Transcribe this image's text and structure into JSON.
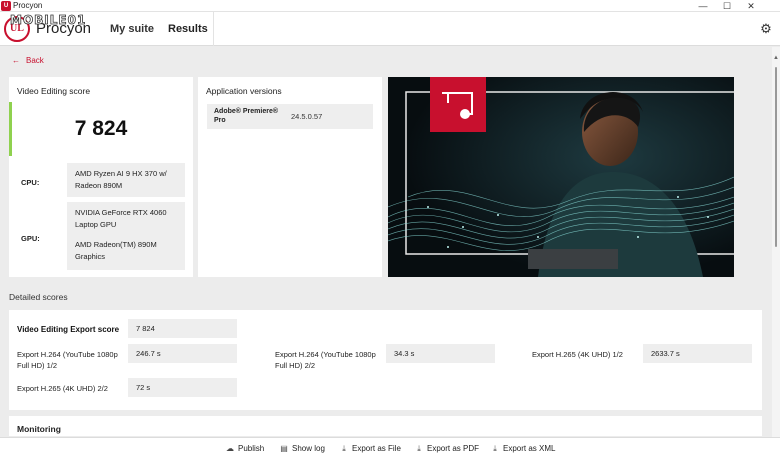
{
  "window": {
    "title": "Procyon",
    "minimize": "—",
    "maximize": "☐",
    "close": "✕"
  },
  "header": {
    "logo_text": "UL",
    "brand": "Procyon",
    "watermark": "MOBILE01",
    "tabs": [
      {
        "label": "My suite",
        "active": false
      },
      {
        "label": "Results",
        "active": true
      }
    ]
  },
  "back_label": "Back",
  "score_card": {
    "title": "Video Editing score",
    "score": "7 824",
    "accent_color": "#8fd14f",
    "cpu_label": "CPU:",
    "cpu_value": "AMD Ryzen AI 9 HX 370 w/ Radeon 890M",
    "gpu_label": "GPU:",
    "gpu_value_1": "NVIDIA GeForce RTX 4060 Laptop GPU",
    "gpu_value_2": "AMD Radeon(TM) 890M Graphics"
  },
  "apps_card": {
    "title": "Application versions",
    "app_name": "Adobe® Premiere® Pro",
    "app_version": "24.5.0.57"
  },
  "hero": {
    "badge_color": "#c8102e"
  },
  "detailed": {
    "section_title": "Detailed scores",
    "main_label": "Video Editing Export score",
    "main_value": "7 824",
    "rows": [
      {
        "label": "Export H.264 (YouTube 1080p Full HD) 1/2",
        "value": "246.7 s"
      },
      {
        "label": "Export H.264 (YouTube 1080p Full HD) 2/2",
        "value": "34.3 s"
      },
      {
        "label": "Export H.265 (4K UHD) 1/2",
        "value": "2633.7 s"
      },
      {
        "label": "Export H.265 (4K UHD) 2/2",
        "value": "72 s"
      }
    ]
  },
  "monitoring_title": "Monitoring",
  "footer": {
    "publish": "Publish",
    "show_log": "Show log",
    "export_file": "Export as File",
    "export_pdf": "Export as PDF",
    "export_xml": "Export as XML"
  },
  "brand_color": "#c8102e"
}
